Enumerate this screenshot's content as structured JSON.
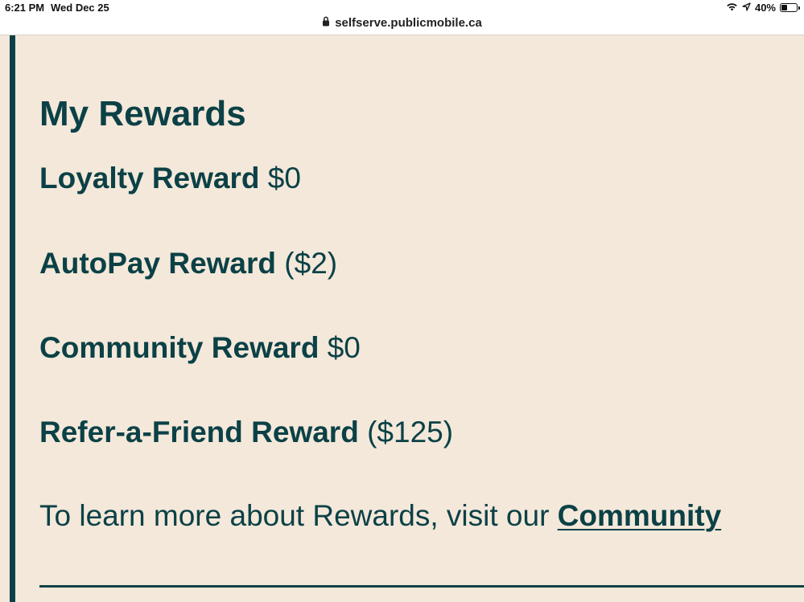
{
  "status_bar": {
    "time": "6:21 PM",
    "date": "Wed Dec 25",
    "battery_percent": "40%",
    "battery_level": 0.4,
    "icons": [
      "wifi-icon",
      "location-arrow-icon",
      "battery-icon"
    ]
  },
  "browser": {
    "url": "selfserve.publicmobile.ca",
    "secure_icon": "lock-icon"
  },
  "page": {
    "title": "My Rewards",
    "rewards": [
      {
        "name": "Loyalty Reward",
        "value": "$0"
      },
      {
        "name": "AutoPay Reward",
        "value": "($2)"
      },
      {
        "name": "Community Reward",
        "value": "$0"
      },
      {
        "name": "Refer-a-Friend Reward",
        "value": "($125)"
      }
    ],
    "learn_more_text": "To learn more about Rewards, visit our",
    "community_link": "Community"
  },
  "colors": {
    "background": "#f4e8da",
    "primary_text": "#0b4146",
    "accent_rule": "#0b4146"
  }
}
